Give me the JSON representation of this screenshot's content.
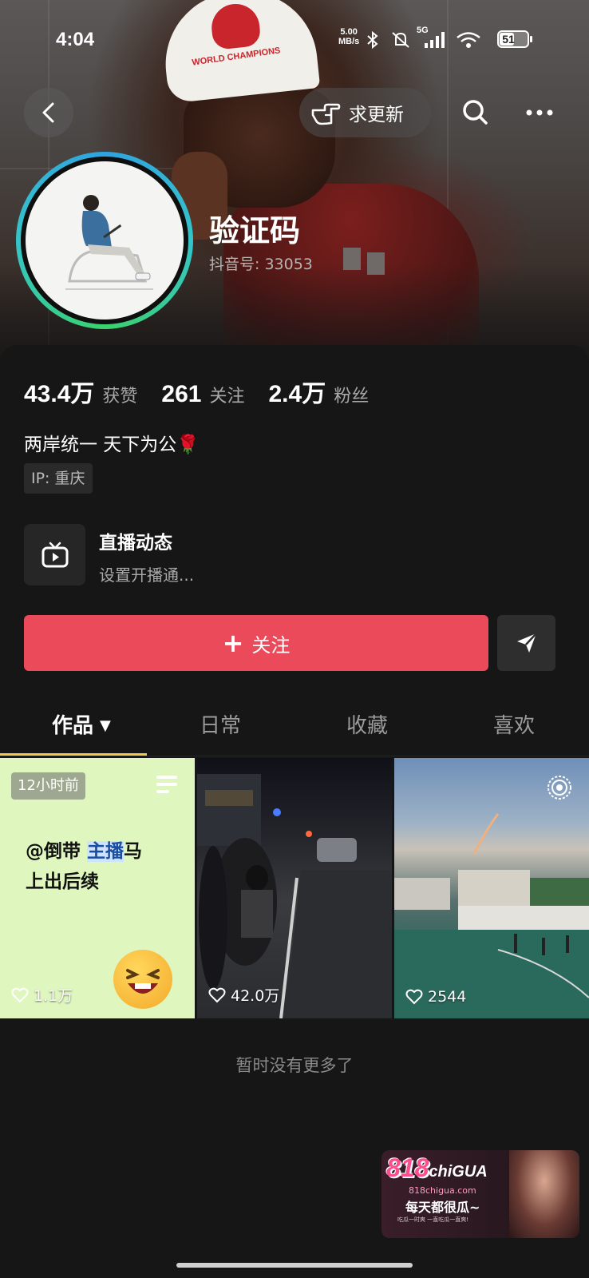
{
  "status_bar": {
    "time": "4:04",
    "net_speed_value": "5.00",
    "net_speed_unit": "MB/s",
    "network": "5G",
    "battery": "51"
  },
  "header": {
    "update_label": "求更新"
  },
  "profile": {
    "name": "验证码",
    "douyin_id": "抖音号: 33053",
    "stats": [
      {
        "value": "43.4万",
        "label": "获赞"
      },
      {
        "value": "261",
        "label": "关注"
      },
      {
        "value": "2.4万",
        "label": "粉丝"
      }
    ],
    "bio": "两岸统一 天下为公🌹",
    "ip": "IP: 重庆"
  },
  "live": {
    "title": "直播动态",
    "subtitle": "设置开播通..."
  },
  "actions": {
    "follow_label": "关注"
  },
  "tabs": [
    {
      "label": "作品",
      "active": true
    },
    {
      "label": "日常",
      "active": false
    },
    {
      "label": "收藏",
      "active": false
    },
    {
      "label": "喜欢",
      "active": false
    }
  ],
  "videos": [
    {
      "badge": "12小时前",
      "text_line1_a": "@倒带 ",
      "text_line1_hl": "主播",
      "text_line1_b": "马",
      "text_line2": "上出后续",
      "likes": "1.1万"
    },
    {
      "likes": "42.0万"
    },
    {
      "likes": "2544"
    }
  ],
  "footer": {
    "no_more": "暂时没有更多了"
  },
  "ad": {
    "brand": "818",
    "brand_suffix": "chiGUA",
    "url": "818chigua.com",
    "slogan": "每天都很瓜~",
    "fine_print": "吃瓜一时爽 一直吃瓜一直爽!"
  }
}
